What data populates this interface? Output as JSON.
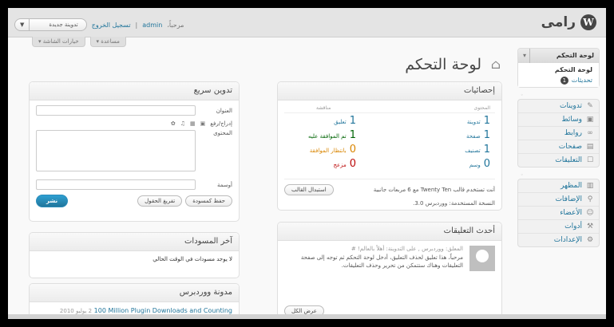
{
  "header": {
    "site_title": "رامی",
    "logo_letter": "W",
    "greeting": "مرحباً،",
    "username": "admin",
    "logout": "تسجيل الخروج",
    "favorite_action": "تدوينة جديدة",
    "favorite_arrow": "▼",
    "sep": "|"
  },
  "screen_options": [
    "خيارات الشاشة ▾",
    "مساعدة ▾"
  ],
  "page_title": "لوحة التحكم",
  "sidebar": {
    "dashboard_label": "لوحة التحكم",
    "dashboard_sub": [
      "لوحة التحكم",
      "تحديثات"
    ],
    "updates_count": "1",
    "group1": [
      {
        "label": "تدوينات",
        "icon": "pin-icon"
      },
      {
        "label": "وسائط",
        "icon": "media-icon"
      },
      {
        "label": "روابط",
        "icon": "link-icon"
      },
      {
        "label": "صفحات",
        "icon": "page-icon"
      },
      {
        "label": "التعليقات",
        "icon": "comment-icon"
      }
    ],
    "group2": [
      {
        "label": "المظهر",
        "icon": "appearance-icon"
      },
      {
        "label": "الإضافات",
        "icon": "plugin-icon"
      },
      {
        "label": "الأعضاء",
        "icon": "users-icon"
      },
      {
        "label": "أدوات",
        "icon": "tools-icon"
      },
      {
        "label": "الإعدادات",
        "icon": "settings-icon"
      }
    ]
  },
  "stats": {
    "title": "إحصائيات",
    "col_content": "المحتوى",
    "col_discussion": "مناقشة",
    "content": [
      {
        "num": "1",
        "label": "تدوينة"
      },
      {
        "num": "1",
        "label": "صفحة"
      },
      {
        "num": "1",
        "label": "تصنيف"
      },
      {
        "num": "0",
        "label": "وسم"
      }
    ],
    "discussion": [
      {
        "num": "1",
        "label": "تعليق",
        "kind": ""
      },
      {
        "num": "1",
        "label": "تم الموافقة عليه",
        "kind": "green"
      },
      {
        "num": "0",
        "label": "بانتظار الموافقة",
        "kind": "orange"
      },
      {
        "num": "0",
        "label": "مزعج",
        "kind": "red"
      }
    ],
    "theme_text": "أنت تستخدم قالب Twenty Ten مع 6 مربعات جانبية",
    "change_theme": "استبدال القالب",
    "version_text": "النسخة المستخدمة: ووردبرس 3.0."
  },
  "recent_comments": {
    "title": "أحدث التعليقات",
    "meta": "المعلق: ووردبرس , على التدوينة: أهلاً بالعالم! #",
    "text": "مرحباً، هذا تعليق لحذف التعليق، أدخل لوحة التحكم ثم توجه إلى صفحة التعليقات وهناك ستتمكن من تحرير وحذف التعليقات.",
    "view_all": "عرض الكل"
  },
  "quick_press": {
    "title": "تدوين سريع",
    "title_label": "العنوان",
    "upload_label": "إدراج/رفع",
    "content_label": "المحتوى",
    "tags_label": "أوسمة",
    "save_draft": "حفظ كمسودة",
    "reset": "تفريغ الحقول",
    "publish": "نشر"
  },
  "drafts": {
    "title": "آخر المسودات",
    "empty": "لا يوجد مسودات في الوقت الحالي"
  },
  "news": {
    "title": "مدونة ووردبرس",
    "item": "100 Million Plugin Downloads and Counting",
    "date": "2 يوليو 2010"
  }
}
